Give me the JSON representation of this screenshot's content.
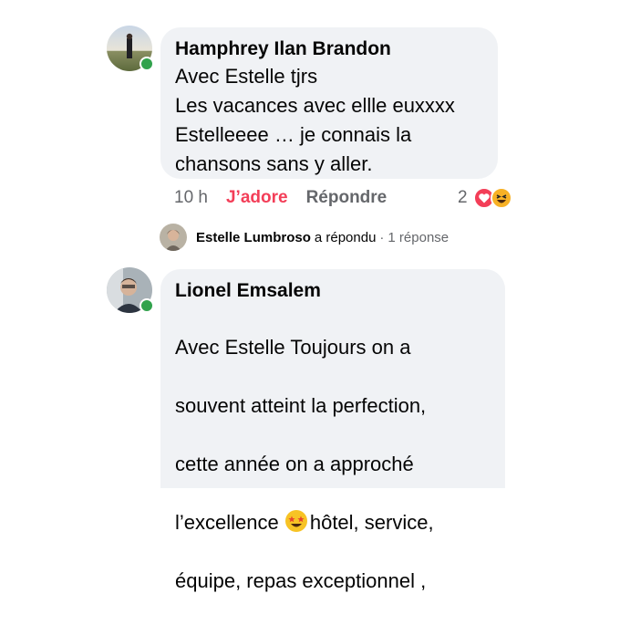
{
  "comments": [
    {
      "author": "Hamphrey Ilan Brandon",
      "text": "Avec Estelle tjrs\nLes vacances avec ellle euxxxx\nEstelleeee … je connais la\nchansons sans y aller.",
      "time": "10 h",
      "love_label": "J’adore",
      "reply_label": "Répondre",
      "reaction_count": "2",
      "reaction_icons": [
        "heart-icon",
        "haha-icon"
      ]
    },
    {
      "author": "Lionel Emsalem",
      "text_lines": [
        "Avec Estelle Toujours on a",
        "souvent atteint la perfection,",
        "cette année on a approché",
        "l’excellence ",
        "hôtel, service,",
        "équipe, repas exceptionnel ,"
      ],
      "inline_emoji": "star-struck-emoji-icon"
    }
  ],
  "reply_summary": {
    "name": "Estelle Lumbroso",
    "verb": "a répondu",
    "separator": "·",
    "count": "1 réponse"
  },
  "colors": {
    "bubble": "#f0f2f5",
    "love": "#f33e58",
    "muted": "#65676b",
    "online": "#31a24c"
  }
}
